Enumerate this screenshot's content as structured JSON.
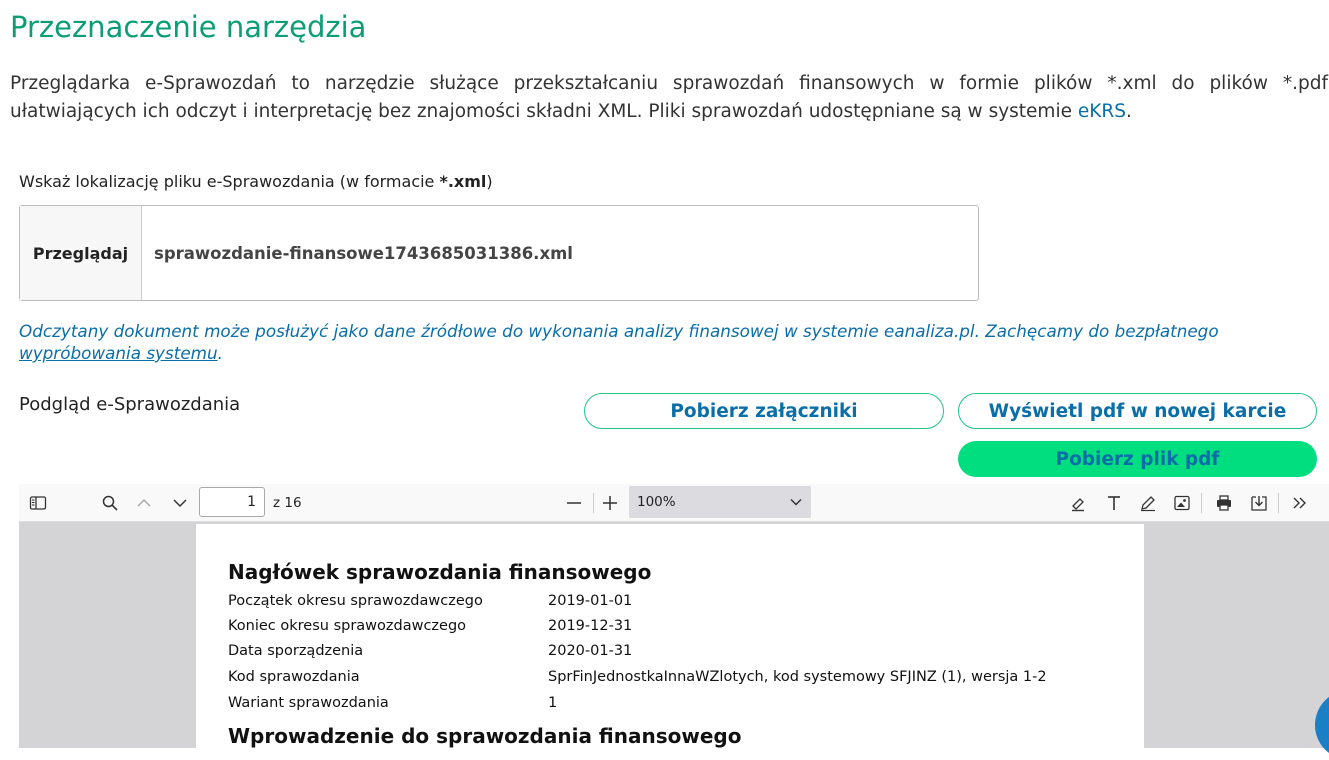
{
  "header": {
    "title": "Przeznaczenie narzędzia",
    "intro_text": "Przeglądarka e-Sprawozdań to narzędzie służące przekształcaniu sprawozdań finansowych w formie plików *.xml do plików *.pdf ułatwiających ich odczyt i interpretację bez znajomości składni XML. Pliki sprawozdań udostępniane są w systemie ",
    "intro_link": "eKRS",
    "intro_end": "."
  },
  "file_picker": {
    "label_prefix": "Wskaż lokalizację pliku e-Sprawozdania (w formacie ",
    "label_format": "*.xml",
    "label_suffix": ")",
    "browse_label": "Przeglądaj",
    "file_name": "sprawozdanie-finansowe1743685031386.xml"
  },
  "notice": {
    "text": "Odczytany dokument może posłużyć jako dane źródłowe do wykonania analizy finansowej w systemie eanaliza.pl. Zachęcamy do bezpłatnego ",
    "link": "wypróbowania systemu",
    "end": "."
  },
  "preview": {
    "label": "Podgląd e-Sprawozdania",
    "btn_attachments": "Pobierz załączniki",
    "btn_open_pdf": "Wyświetl pdf w nowej karcie",
    "btn_download_pdf": "Pobierz plik pdf"
  },
  "pdf_viewer": {
    "page_number": "1",
    "page_count": "z 16",
    "zoom": "100%"
  },
  "pdf_content": {
    "heading1": "Nagłówek sprawozdania finansowego",
    "rows": [
      {
        "label": "Początek okresu sprawozdawczego",
        "value": "2019-01-01"
      },
      {
        "label": "Koniec okresu sprawozdawczego",
        "value": "2019-12-31"
      },
      {
        "label": "Data sporządzenia",
        "value": "2020-01-31"
      },
      {
        "label": "Kod sprawozdania",
        "value": "SprFinJednostkaInnaWZlotych, kod systemowy SFJINZ (1), wersja 1-2"
      },
      {
        "label": "Wariant sprawozdania",
        "value": "1"
      }
    ],
    "heading2": "Wprowadzenie do sprawozdania finansowego"
  },
  "colors": {
    "title_green": "#0b9e76",
    "link_blue": "#0a6ea8",
    "button_green": "#00de7f",
    "button_border": "#22c486"
  }
}
